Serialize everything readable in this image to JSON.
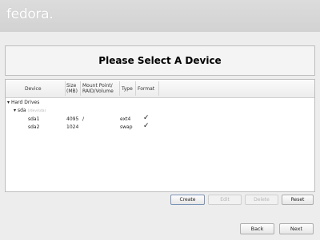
{
  "brand": {
    "logo_text": "fedora."
  },
  "page": {
    "title": "Please Select A Device"
  },
  "table": {
    "headers": {
      "device": "Device",
      "size": "Size\n(MB)",
      "mount": "Mount Point/\nRAID/Volume",
      "type": "Type",
      "format": "Format"
    },
    "groups": [
      {
        "label": "Hard Drives",
        "disks": [
          {
            "name": "sda",
            "detail": "(/dev/sda)",
            "partitions": [
              {
                "device": "sda1",
                "size": "4095",
                "mount": "/",
                "type": "ext4",
                "format": "✓"
              },
              {
                "device": "sda2",
                "size": "1024",
                "mount": "",
                "type": "swap",
                "format": "✓"
              }
            ]
          }
        ]
      }
    ]
  },
  "actions": {
    "create": "Create",
    "edit": "Edit",
    "delete": "Delete",
    "reset": "Reset"
  },
  "nav": {
    "back": "Back",
    "next": "Next"
  },
  "colors": {
    "background": "#ededed",
    "panel": "#ffffff",
    "header_bar": "#d4d4d4"
  }
}
